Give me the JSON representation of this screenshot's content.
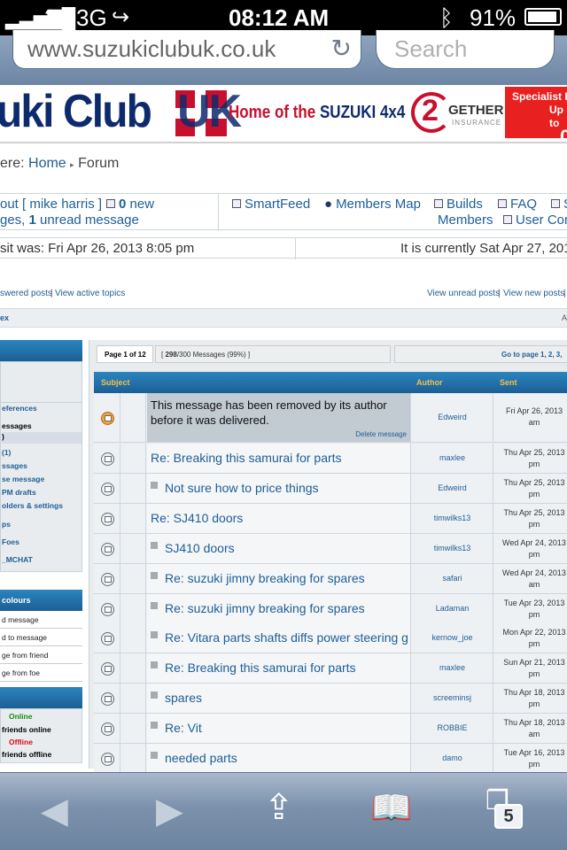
{
  "status": {
    "carrier": "3",
    "network": "3G",
    "time": "08:12 AM",
    "battery": "91%"
  },
  "browser": {
    "url": "www.suzukiclubuk.co.uk",
    "search_placeholder": "Search"
  },
  "banner": {
    "logo": "uki Club",
    "uk": "UK",
    "tagline_pre": "Home of the ",
    "tagline_brand": "SUZUKI 4x4",
    "insurer_num": "2",
    "insurer_word": "GETHER",
    "insurer_sub": "INSURANCE",
    "specialist_line1": "Specialist In",
    "specialist_line2": "Up to",
    "specialist_big": "0"
  },
  "breadcrumb": {
    "prefix": "ere: ",
    "home": "Home",
    "current": "Forum"
  },
  "userbar": {
    "logout": "out [ mike harris ]",
    "new_count": "0",
    "new_label": " new",
    "messages_pre": "ges, ",
    "unread_count": "1",
    "unread_label": " unread message",
    "smartfeed": "SmartFeed",
    "members_map": "Members Map",
    "builds": "Builds",
    "faq": "FAQ",
    "s_label": "S",
    "members": "Members",
    "user_con": "User Con"
  },
  "dates": {
    "last_visit": "sit was: Fri Apr 26, 2013 8:05 pm",
    "current": "It is currently Sat Apr 27, 201"
  },
  "quicklinks": {
    "unanswered": "swered posts",
    "active": "View active topics",
    "unread": "View unread posts",
    "new_posts": "View new posts"
  },
  "navstrip": {
    "left": "ex",
    "right": "A"
  },
  "sidebar": {
    "prefs": "eferences",
    "messages": "essages",
    "item_paren": ")",
    "item_one": "(1)",
    "ssages": "ssages",
    "se_message": "se message",
    "pm_drafts": "PM drafts",
    "folders": "olders & settings",
    "ps": "ps",
    "foes": "Foes",
    "mchat": "_MCHAT",
    "colours_head": "colours",
    "colour_items": [
      "d message",
      "d to message",
      "ge from friend",
      "ge from foe"
    ],
    "online": "Online",
    "friends_online": "friends online",
    "offline": "Offline",
    "friends_offline": "friends offline"
  },
  "pagination": {
    "label": "Page 1 of 12",
    "count_bold": "298",
    "count_rest": "/300 Messages (99%) ]",
    "count_open": "[ ",
    "goto": "Go to page ",
    "pages": "1, 2, 3,"
  },
  "table": {
    "headers": {
      "subject": "Subject",
      "author": "Author",
      "sent": "Sent"
    },
    "removed": {
      "text": "This message has been removed by its author before it was delivered.",
      "delete": "Delete message",
      "author": "Edweird",
      "sent_date": "Fri Apr 26, 2013",
      "sent_ampm": "am"
    },
    "rows": [
      {
        "subject": "Re: Breaking this samurai for parts",
        "author": "maxlee",
        "date": "Thu Apr 25, 2013",
        "ampm": "pm",
        "reply": false
      },
      {
        "subject": "Not sure how to price things",
        "author": "Edweird",
        "date": "Thu Apr 25, 2013",
        "ampm": "pm",
        "reply": true
      },
      {
        "subject": "Re: SJ410 doors",
        "author": "timwilks13",
        "date": "Thu Apr 25, 2013",
        "ampm": "pm",
        "reply": false
      },
      {
        "subject": "SJ410 doors",
        "author": "timwilks13",
        "date": "Wed Apr 24, 2013",
        "ampm": "pm",
        "reply": true
      },
      {
        "subject": "Re: suzuki jimny breaking for spares",
        "author": "safari",
        "date": "Wed Apr 24, 2013",
        "ampm": "am",
        "reply": true
      },
      {
        "subject": "Re: suzuki jimny breaking for spares",
        "author": "Ladaman",
        "date": "Tue Apr 23, 2013",
        "ampm": "pm",
        "reply": true
      },
      {
        "subject": "Re: Vitara parts shafts diffs power steering g",
        "author": "kernow_joe",
        "date": "Mon Apr 22, 2013",
        "ampm": "pm",
        "reply": true
      },
      {
        "subject": "Re: Breaking this samurai for parts",
        "author": "maxlee",
        "date": "Sun Apr 21, 2013",
        "ampm": "pm",
        "reply": true
      },
      {
        "subject": "spares",
        "author": "screeminsj",
        "date": "Thu Apr 18, 2013",
        "ampm": "pm",
        "reply": true
      },
      {
        "subject": "Re: Vit",
        "author": "ROBBIE",
        "date": "Thu Apr 18, 2013",
        "ampm": "am",
        "reply": true
      },
      {
        "subject": "needed parts",
        "author": "damo",
        "date": "Tue Apr 16, 2013",
        "ampm": "pm",
        "reply": true
      }
    ]
  },
  "toolbar": {
    "tabs_count": "5"
  },
  "colors": {
    "accent": "#1f5e96",
    "header_blue": "#1b5f94",
    "header_text": "#f2c04a",
    "online": "#1a8a1a",
    "offline": "#d0101a"
  }
}
